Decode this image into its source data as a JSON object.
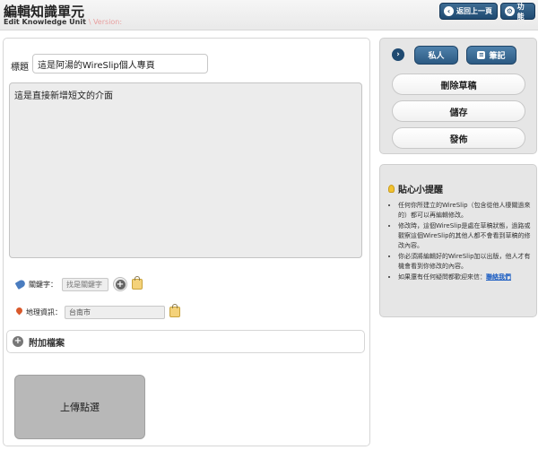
{
  "header": {
    "title": "編輯知識單元",
    "subtitle": "Edit Knowledge Unit",
    "version_label": "\\ Version:",
    "back_button": "返回上一頁",
    "function_button": "功能",
    "back_icon": "‹",
    "function_icon": "⚙"
  },
  "form": {
    "title_label": "標題",
    "title_value": "這是阿湯的WireSlip個人專頁",
    "body_text": "這是直接新增短文的介面",
    "keyword_label": "關鍵字：",
    "keyword_placeholder": "找是關鍵字",
    "geo_label": "地理資訊：",
    "geo_value": "台南市",
    "attach_label": "附加檔案",
    "upload_label": "上傳點選"
  },
  "sidebar": {
    "private_button": "私人",
    "note_button": "筆記",
    "delete_draft_button": "刪除草稿",
    "save_button": "儲存",
    "publish_button": "發佈"
  },
  "tips": {
    "title": "貼心小提醒",
    "items": [
      "任何你所建立的WireSlip（包含從他人棲關過來的）都可以再編輯修改。",
      "修改時，這個WireSlip是處在草稿狀態，過路或觀察這個WireSlip的其他人都不會看到草稿的修改內容。",
      "你必須將編輯好的WireSlip加以出版，他人才有機會看到你修改的內容。",
      "如果還有任何疑問都歡迎來信："
    ],
    "contact_link": "聯絡我們"
  },
  "colors": {
    "accent": "#1f4a71",
    "panel_bg": "#e6e6e6",
    "upload_bg": "#b8b8b8"
  }
}
